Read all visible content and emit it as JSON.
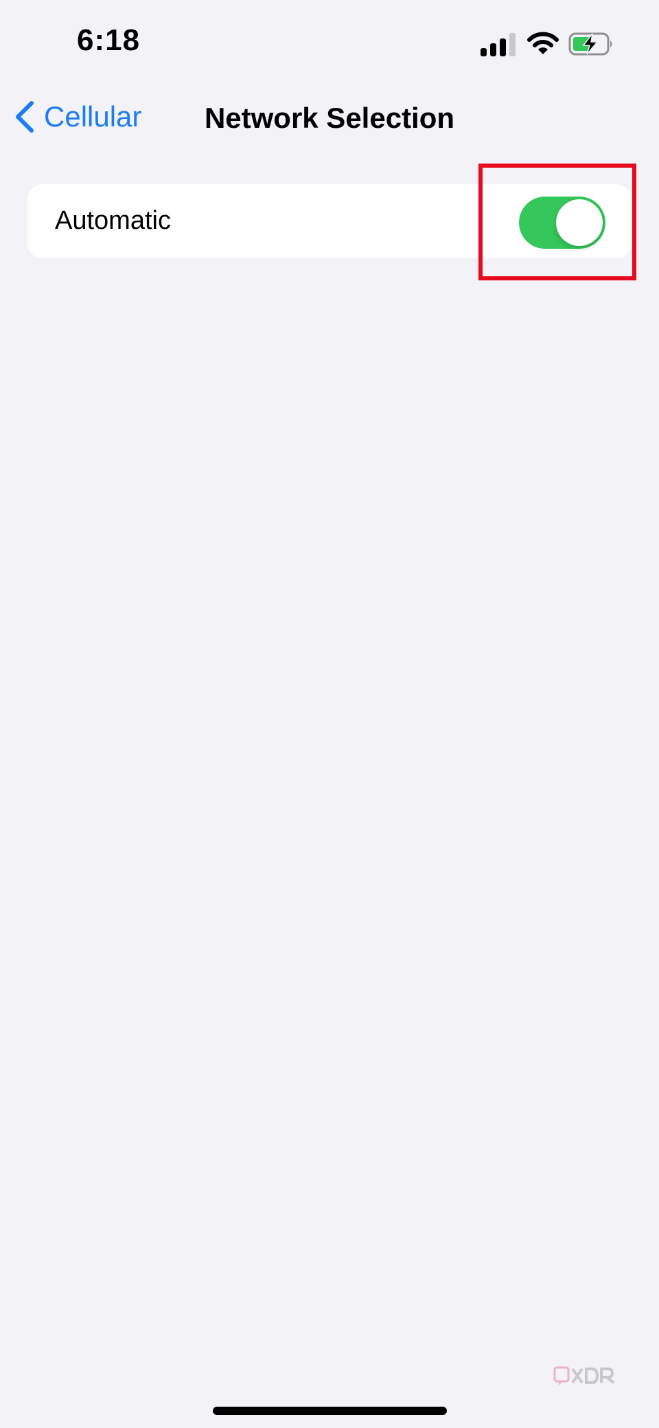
{
  "status_bar": {
    "time": "6:18",
    "signal_icon": "cellular-signal-icon",
    "wifi_icon": "wifi-icon",
    "battery_icon": "battery-charging-icon"
  },
  "nav": {
    "back_label": "Cellular",
    "back_icon": "chevron-left-icon",
    "title": "Network Selection"
  },
  "settings": {
    "rows": [
      {
        "label": "Automatic",
        "toggle_on": true
      }
    ]
  },
  "watermark": {
    "logo": "xda-logo"
  },
  "colors": {
    "background": "#f2f2f7",
    "accent": "#1c7cf2",
    "toggle_on": "#34c759",
    "highlight": "#e60b1f"
  }
}
